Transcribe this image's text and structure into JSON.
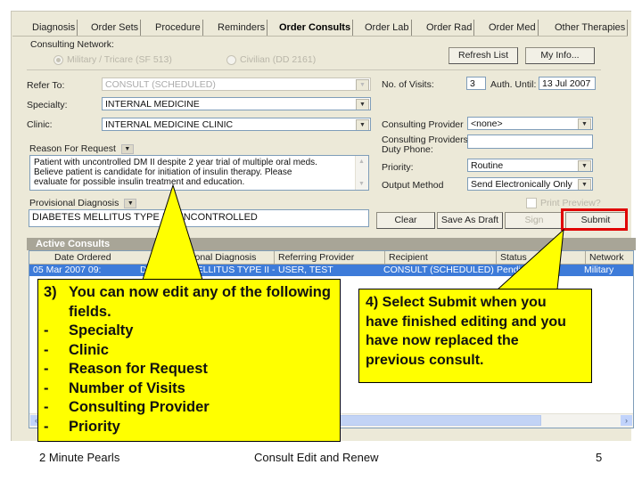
{
  "tabs": [
    {
      "label": "Diagnosis",
      "active": false
    },
    {
      "label": "Order Sets",
      "active": false
    },
    {
      "label": "Procedure",
      "active": false
    },
    {
      "label": "Reminders",
      "active": false
    },
    {
      "label": "Order Consults",
      "active": true
    },
    {
      "label": "Order Lab",
      "active": false
    },
    {
      "label": "Order Rad",
      "active": false
    },
    {
      "label": "Order Med",
      "active": false
    },
    {
      "label": "Other Therapies",
      "active": false
    }
  ],
  "network": {
    "label": "Consulting Network:",
    "options": [
      {
        "label": "Military / Tricare (SF 513)",
        "selected": true
      },
      {
        "label": "Civilian (DD 2161)",
        "selected": false
      }
    ]
  },
  "buttons": {
    "refresh_list": "Refresh List",
    "my_info": "My Info...",
    "clear": "Clear",
    "save_as_draft": "Save As Draft",
    "sign": "Sign",
    "submit": "Submit"
  },
  "form": {
    "refer_to": {
      "label": "Refer To:",
      "value": "CONSULT (SCHEDULED)"
    },
    "specialty": {
      "label": "Specialty:",
      "value": "INTERNAL MEDICINE"
    },
    "clinic": {
      "label": "Clinic:",
      "value": "INTERNAL MEDICINE CLINIC"
    },
    "reason": {
      "label": "Reason For Request",
      "lines": [
        "Patient with uncontrolled DM II despite 2 year trial of multiple oral meds.",
        "Believe patient is candidate for initiation of insulin therapy.  Please",
        "evaluate for possible insulin treatment and education."
      ]
    },
    "provisional_diagnosis": {
      "label": "Provisional Diagnosis",
      "value": "DIABETES MELLITUS TYPE II - UNCONTROLLED"
    },
    "no_of_visits": {
      "label": "No. of Visits:",
      "value": "3"
    },
    "auth_until": {
      "label": "Auth. Until:",
      "value": "13 Jul 2007"
    },
    "consulting_provider": {
      "label": "Consulting Provider",
      "value": "<none>"
    },
    "duty_phone": {
      "label_line1": "Consulting Providers",
      "label_line2": "Duty Phone:",
      "value": ""
    },
    "priority": {
      "label": "Priority:",
      "value": "Routine"
    },
    "output_method": {
      "label": "Output Method",
      "value": "Send Electronically Only"
    },
    "print_preview": {
      "label": "Print Preview?",
      "checked": false
    }
  },
  "active_consults": {
    "title": "Active Consults",
    "columns": [
      "Date Ordered",
      "Provisional Diagnosis",
      "Referring Provider",
      "Recipient",
      "Status",
      "Network"
    ],
    "rows": [
      [
        "05 Mar 2007 09:",
        "DIABETES MELLITUS TYPE II - UN",
        "USER, TEST",
        "CONSULT (SCHEDULED)",
        "Pending",
        "Military"
      ]
    ]
  },
  "callouts": {
    "step3": {
      "number": "3)",
      "intro_line1": "You can now edit any of the following",
      "intro_line2": "fields.",
      "items": [
        "Specialty",
        "Clinic",
        "Reason for Request",
        "Number of Visits",
        "Consulting Provider",
        "Priority"
      ]
    },
    "step4": {
      "lines": [
        "4) Select Submit when you",
        "have finished editing and you",
        "have now replaced the",
        "previous consult."
      ]
    }
  },
  "footer": {
    "left": "2 Minute Pearls",
    "center": "Consult Edit and Renew",
    "page": "5"
  },
  "colors": {
    "highlight_box": "#e00000",
    "callout_fill": "#ffff00",
    "selection": "#3d7bd9"
  }
}
